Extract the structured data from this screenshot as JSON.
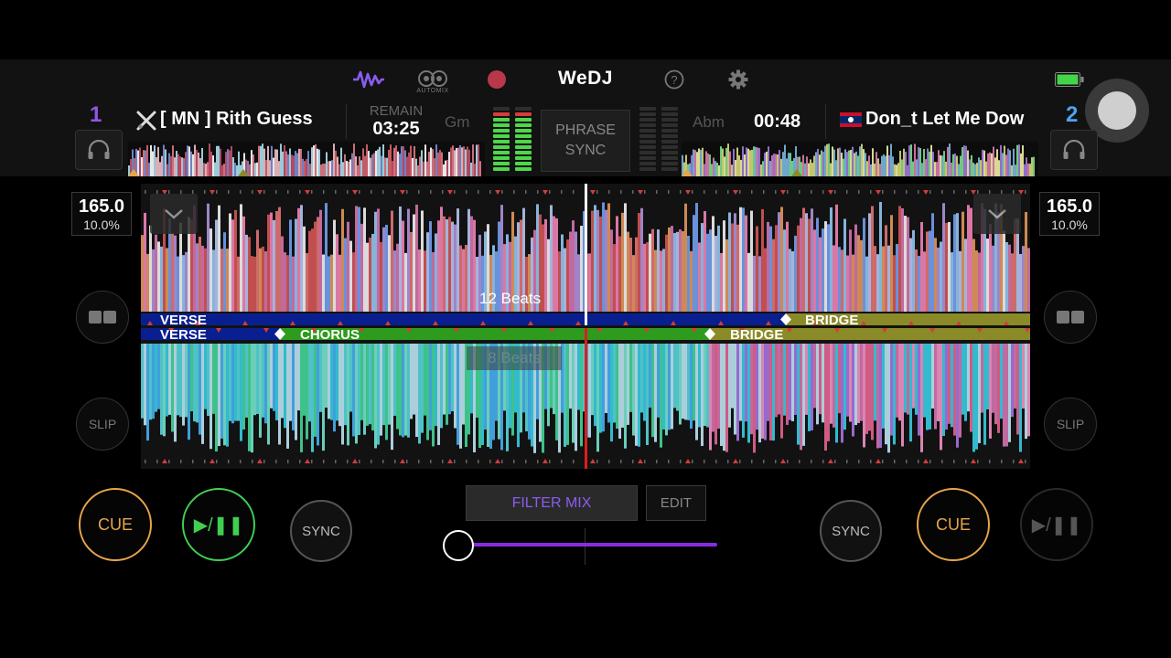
{
  "app": {
    "title": "WeDJ"
  },
  "toolbar": {
    "automix_label": "AUTOMIX"
  },
  "deck1": {
    "number": "1",
    "track_title": "[ MN ] Rith Guess",
    "remain_label": "REMAIN",
    "time": "03:25",
    "key": "Gm",
    "bpm": "165.0",
    "pitch": "10.0%",
    "cue_label": "CUE",
    "play_label": "▶/❚❚",
    "sync_label": "SYNC",
    "slip_label": "SLIP",
    "beats_label": "12 Beats",
    "phrases": [
      "VERSE",
      "BRIDGE"
    ]
  },
  "deck2": {
    "number": "2",
    "track_title": "Don_t Let Me Dow",
    "time": "00:48",
    "key": "Abm",
    "bpm": "165.0",
    "pitch": "10.0%",
    "cue_label": "CUE",
    "play_label": "▶/❚❚",
    "sync_label": "SYNC",
    "slip_label": "SLIP",
    "beats_label": "8 Beats",
    "phrases": [
      "VERSE",
      "CHORUS",
      "BRIDGE"
    ]
  },
  "center": {
    "phrase_sync_line1": "PHRASE",
    "phrase_sync_line2": "SYNC",
    "filter_mix_label": "FILTER MIX",
    "edit_label": "EDIT",
    "crossfader_position": 0.0
  },
  "colors": {
    "accent_purple": "#8a5cf0",
    "deck_number_1": "#8e57e6",
    "deck_number_2": "#4fa3f0",
    "cue": "#e6a54a",
    "play": "#3fcf52",
    "verse_band": "#0a1f8f",
    "chorus_band": "#2e9b1e",
    "bridge_band": "#8b8a28",
    "playhead_top": "#ffffff",
    "playhead_bottom": "#e01c1c"
  }
}
